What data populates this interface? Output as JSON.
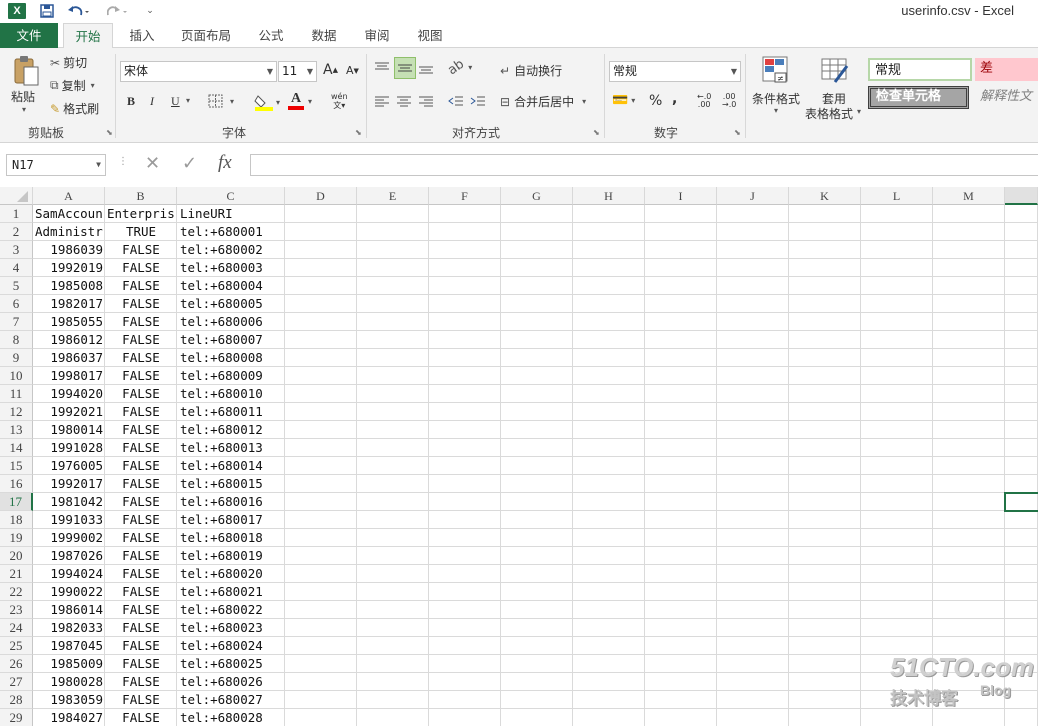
{
  "window": {
    "title": "userinfo.csv - Excel"
  },
  "tabs": [
    "文件",
    "开始",
    "插入",
    "页面布局",
    "公式",
    "数据",
    "审阅",
    "视图"
  ],
  "ribbon": {
    "clipboard": {
      "paste": "粘贴",
      "cut": "剪切",
      "copy": "复制",
      "format_painter": "格式刷",
      "label": "剪贴板"
    },
    "font": {
      "family": "宋体",
      "size": "11",
      "bold": "B",
      "italic": "I",
      "underline": "U",
      "grow": "A",
      "shrink": "A",
      "phonetic": "wén",
      "label": "字体"
    },
    "alignment": {
      "wrap": "自动换行",
      "merge": "合并后居中",
      "label": "对齐方式"
    },
    "number": {
      "format": "常规",
      "percent": "%",
      "comma": ",",
      "label": "数字"
    },
    "styles": {
      "conditional": "条件格式",
      "table1": "套用",
      "table2": "表格格式",
      "normal": "常规",
      "bad": "差",
      "check": "检查单元格",
      "explain": "解释性文"
    }
  },
  "formula_bar": {
    "name_box": "N17",
    "cancel": "✕",
    "enter": "✓",
    "fx": "fx",
    "value": ""
  },
  "columns": [
    "A",
    "B",
    "C",
    "D",
    "E",
    "F",
    "G",
    "H",
    "I",
    "J",
    "K",
    "L",
    "M"
  ],
  "rows": [
    {
      "n": "1",
      "a": "SamAccountName",
      "b": "EnterpriseVoiceEnabled",
      "c": "LineURI"
    },
    {
      "n": "2",
      "a": "Administrator",
      "b": "TRUE",
      "c": "tel:+680001"
    },
    {
      "n": "3",
      "a": "1986039",
      "b": "FALSE",
      "c": "tel:+680002"
    },
    {
      "n": "4",
      "a": "1992019",
      "b": "FALSE",
      "c": "tel:+680003"
    },
    {
      "n": "5",
      "a": "1985008",
      "b": "FALSE",
      "c": "tel:+680004"
    },
    {
      "n": "6",
      "a": "1982017",
      "b": "FALSE",
      "c": "tel:+680005"
    },
    {
      "n": "7",
      "a": "1985055",
      "b": "FALSE",
      "c": "tel:+680006"
    },
    {
      "n": "8",
      "a": "1986012",
      "b": "FALSE",
      "c": "tel:+680007"
    },
    {
      "n": "9",
      "a": "1986037",
      "b": "FALSE",
      "c": "tel:+680008"
    },
    {
      "n": "10",
      "a": "1998017",
      "b": "FALSE",
      "c": "tel:+680009"
    },
    {
      "n": "11",
      "a": "1994020",
      "b": "FALSE",
      "c": "tel:+680010"
    },
    {
      "n": "12",
      "a": "1992021",
      "b": "FALSE",
      "c": "tel:+680011"
    },
    {
      "n": "13",
      "a": "1980014",
      "b": "FALSE",
      "c": "tel:+680012"
    },
    {
      "n": "14",
      "a": "1991028",
      "b": "FALSE",
      "c": "tel:+680013"
    },
    {
      "n": "15",
      "a": "1976005",
      "b": "FALSE",
      "c": "tel:+680014"
    },
    {
      "n": "16",
      "a": "1992017",
      "b": "FALSE",
      "c": "tel:+680015"
    },
    {
      "n": "17",
      "a": "1981042",
      "b": "FALSE",
      "c": "tel:+680016"
    },
    {
      "n": "18",
      "a": "1991033",
      "b": "FALSE",
      "c": "tel:+680017"
    },
    {
      "n": "19",
      "a": "1999002",
      "b": "FALSE",
      "c": "tel:+680018"
    },
    {
      "n": "20",
      "a": "1987026",
      "b": "FALSE",
      "c": "tel:+680019"
    },
    {
      "n": "21",
      "a": "1994024",
      "b": "FALSE",
      "c": "tel:+680020"
    },
    {
      "n": "22",
      "a": "1990022",
      "b": "FALSE",
      "c": "tel:+680021"
    },
    {
      "n": "23",
      "a": "1986014",
      "b": "FALSE",
      "c": "tel:+680022"
    },
    {
      "n": "24",
      "a": "1982033",
      "b": "FALSE",
      "c": "tel:+680023"
    },
    {
      "n": "25",
      "a": "1987045",
      "b": "FALSE",
      "c": "tel:+680024"
    },
    {
      "n": "26",
      "a": "1985009",
      "b": "FALSE",
      "c": "tel:+680025"
    },
    {
      "n": "27",
      "a": "1980028",
      "b": "FALSE",
      "c": "tel:+680026"
    },
    {
      "n": "28",
      "a": "1983059",
      "b": "FALSE",
      "c": "tel:+680027"
    },
    {
      "n": "29",
      "a": "1984027",
      "b": "FALSE",
      "c": "tel:+680028"
    }
  ],
  "watermark": {
    "line1": "51CTO.com",
    "line2": "技术博客",
    "line3": "Blog"
  },
  "colors": {
    "accent": "#217346",
    "bad_fill": "#ffc7ce",
    "bad_text": "#9c0006",
    "check_fill": "#a5a5a5"
  }
}
